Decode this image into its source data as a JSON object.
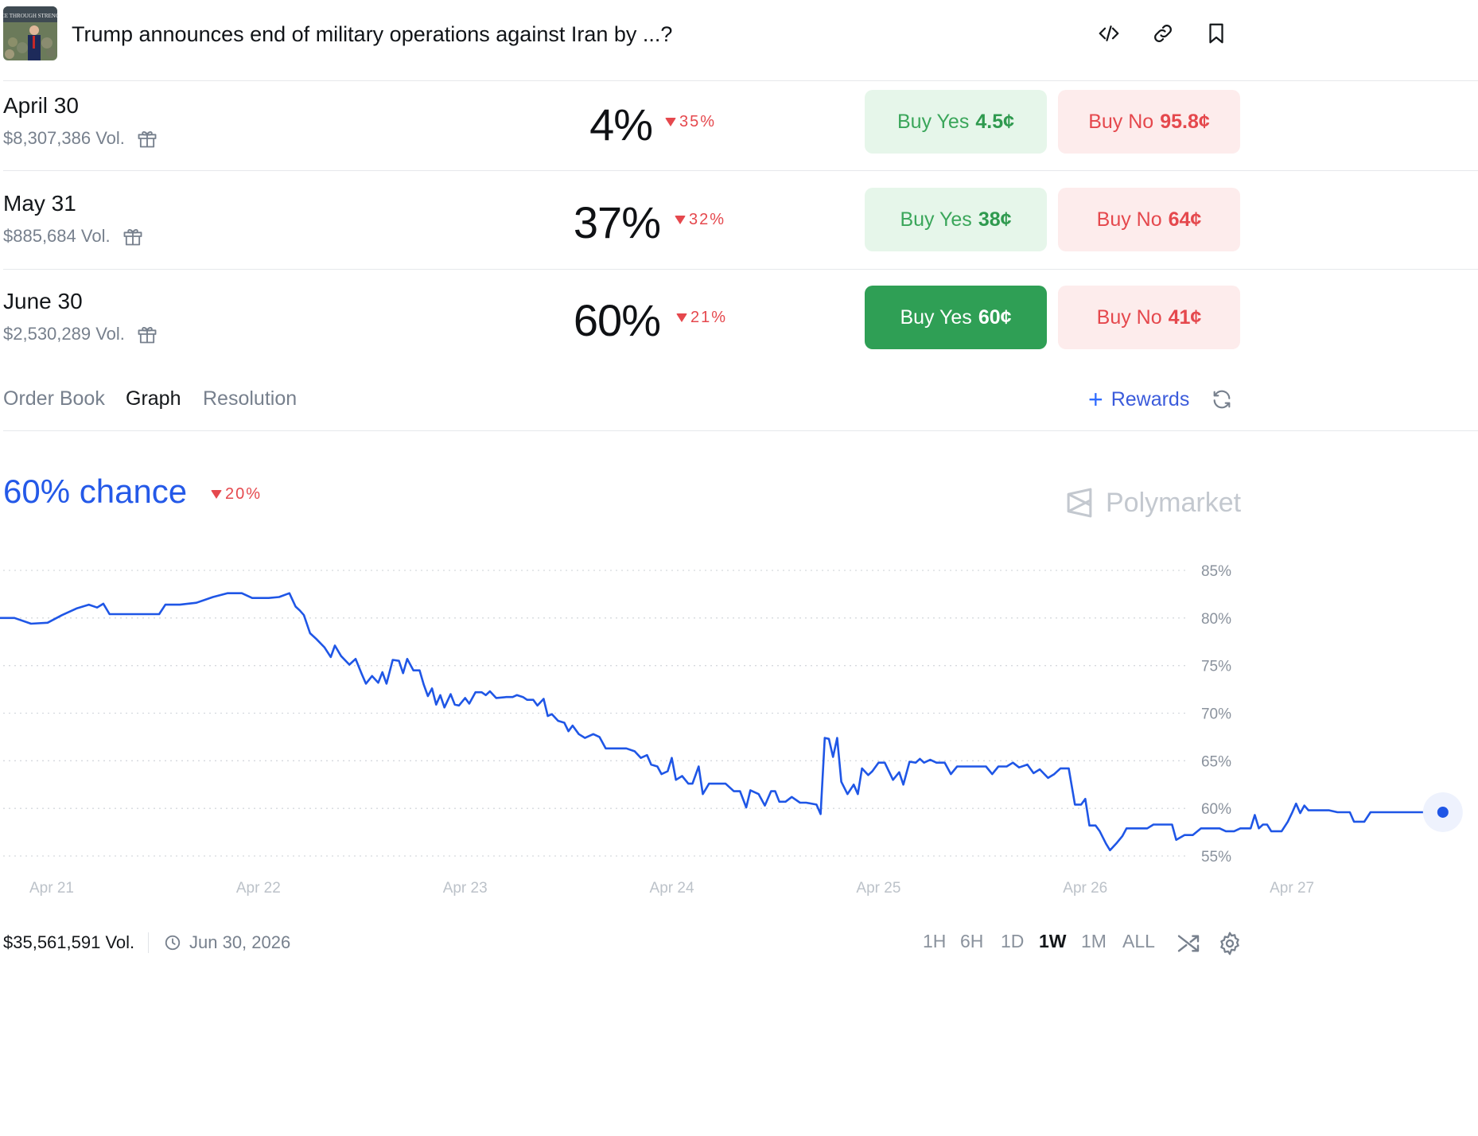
{
  "header": {
    "title": "Trump announces end of military operations against Iran by ...?",
    "thumbnail_caption": "CE THROUGH STRENG"
  },
  "markets": [
    {
      "date": "April 30",
      "volume": "$8,307,386 Vol.",
      "percent": "4%",
      "change": "35%",
      "yes_label": "Buy Yes",
      "yes_price": "4.5¢",
      "no_label": "Buy No",
      "no_price": "95.8¢"
    },
    {
      "date": "May 31",
      "volume": "$885,684 Vol.",
      "percent": "37%",
      "change": "32%",
      "yes_label": "Buy Yes",
      "yes_price": "38¢",
      "no_label": "Buy No",
      "no_price": "64¢"
    },
    {
      "date": "June 30",
      "volume": "$2,530,289 Vol.",
      "percent": "60%",
      "change": "21%",
      "yes_label": "Buy Yes",
      "yes_price": "60¢",
      "no_label": "Buy No",
      "no_price": "41¢"
    }
  ],
  "tabs": [
    "Order Book",
    "Graph",
    "Resolution"
  ],
  "active_tab": "Graph",
  "rewards_label": "Rewards",
  "chance": {
    "label": "60% chance",
    "change": "20%"
  },
  "brand": "Polymarket",
  "colors": {
    "accent": "#2459e8",
    "yes": "#2f9f55",
    "no": "#e5484d"
  },
  "chart_data": {
    "type": "line",
    "ylim": [
      55,
      85
    ],
    "yticks": [
      "85%",
      "80%",
      "75%",
      "70%",
      "65%",
      "60%",
      "55%"
    ],
    "xticks": [
      "Apr 21",
      "Apr 22",
      "Apr 23",
      "Apr 24",
      "Apr 25",
      "Apr 26",
      "Apr 27"
    ],
    "xlim": [
      20.75,
      27.9
    ],
    "series": [
      {
        "values": [
          [
            20.75,
            80
          ],
          [
            20.82,
            80
          ],
          [
            20.9,
            79.4
          ],
          [
            20.98,
            79.5
          ],
          [
            21.05,
            80.3
          ],
          [
            21.12,
            81
          ],
          [
            21.18,
            81.4
          ],
          [
            21.22,
            81.1
          ],
          [
            21.25,
            81.5
          ],
          [
            21.28,
            80.4
          ],
          [
            21.35,
            80.4
          ],
          [
            21.45,
            80.4
          ],
          [
            21.52,
            80.4
          ],
          [
            21.55,
            81.4
          ],
          [
            21.62,
            81.4
          ],
          [
            21.7,
            81.6
          ],
          [
            21.78,
            82.2
          ],
          [
            21.85,
            82.6
          ],
          [
            21.92,
            82.6
          ],
          [
            21.97,
            82.1
          ],
          [
            22.05,
            82.1
          ],
          [
            22.1,
            82.2
          ],
          [
            22.15,
            82.6
          ],
          [
            22.18,
            81.2
          ],
          [
            22.2,
            80.8
          ],
          [
            22.22,
            80.3
          ],
          [
            22.25,
            78.4
          ],
          [
            22.28,
            77.8
          ],
          [
            22.32,
            76.9
          ],
          [
            22.35,
            75.9
          ],
          [
            22.37,
            77.1
          ],
          [
            22.4,
            76
          ],
          [
            22.44,
            75.1
          ],
          [
            22.47,
            75.7
          ],
          [
            22.5,
            74.1
          ],
          [
            22.52,
            73.1
          ],
          [
            22.55,
            73.9
          ],
          [
            22.58,
            73.2
          ],
          [
            22.6,
            74.3
          ],
          [
            22.62,
            73.1
          ],
          [
            22.65,
            75.6
          ],
          [
            22.68,
            75.5
          ],
          [
            22.7,
            74.2
          ],
          [
            22.72,
            75.7
          ],
          [
            22.75,
            74.5
          ],
          [
            22.78,
            74.5
          ],
          [
            22.8,
            73
          ],
          [
            22.82,
            71.8
          ],
          [
            22.84,
            72.6
          ],
          [
            22.86,
            70.9
          ],
          [
            22.88,
            71.9
          ],
          [
            22.9,
            70.6
          ],
          [
            22.93,
            72
          ],
          [
            22.95,
            70.9
          ],
          [
            22.97,
            70.8
          ],
          [
            23,
            71.6
          ],
          [
            23.02,
            71
          ],
          [
            23.05,
            72.2
          ],
          [
            23.08,
            72.2
          ],
          [
            23.1,
            71.9
          ],
          [
            23.12,
            72.3
          ],
          [
            23.15,
            71.6
          ],
          [
            23.2,
            71.7
          ],
          [
            23.23,
            71.7
          ],
          [
            23.25,
            71.9
          ],
          [
            23.28,
            71.7
          ],
          [
            23.3,
            71.4
          ],
          [
            23.33,
            71.4
          ],
          [
            23.35,
            70.8
          ],
          [
            23.38,
            71.5
          ],
          [
            23.4,
            69.7
          ],
          [
            23.42,
            69.9
          ],
          [
            23.45,
            69.2
          ],
          [
            23.48,
            69
          ],
          [
            23.5,
            68.1
          ],
          [
            23.52,
            68.7
          ],
          [
            23.55,
            67.8
          ],
          [
            23.58,
            67.4
          ],
          [
            23.62,
            67.8
          ],
          [
            23.65,
            67.5
          ],
          [
            23.68,
            66.3
          ],
          [
            23.72,
            66.3
          ],
          [
            23.78,
            66.3
          ],
          [
            23.82,
            66
          ],
          [
            23.85,
            65.3
          ],
          [
            23.88,
            65.6
          ],
          [
            23.9,
            64.6
          ],
          [
            23.93,
            64.4
          ],
          [
            23.95,
            63.6
          ],
          [
            23.98,
            63.9
          ],
          [
            24,
            65.3
          ],
          [
            24.02,
            63
          ],
          [
            24.05,
            63.4
          ],
          [
            24.08,
            62.6
          ],
          [
            24.1,
            62.6
          ],
          [
            24.13,
            64.4
          ],
          [
            24.15,
            61.5
          ],
          [
            24.18,
            62.6
          ],
          [
            24.22,
            62.6
          ],
          [
            24.26,
            62.6
          ],
          [
            24.3,
            61.8
          ],
          [
            24.33,
            61.8
          ],
          [
            24.36,
            60.1
          ],
          [
            24.38,
            61.9
          ],
          [
            24.42,
            61.5
          ],
          [
            24.45,
            60.3
          ],
          [
            24.48,
            61.8
          ],
          [
            24.5,
            61.8
          ],
          [
            24.52,
            60.7
          ],
          [
            24.55,
            60.7
          ],
          [
            24.58,
            61.2
          ],
          [
            24.62,
            60.6
          ],
          [
            24.65,
            60.6
          ],
          [
            24.7,
            60.4
          ],
          [
            24.72,
            59.4
          ],
          [
            24.74,
            67.4
          ],
          [
            24.76,
            67.3
          ],
          [
            24.78,
            65.4
          ],
          [
            24.8,
            67.4
          ],
          [
            24.82,
            62.8
          ],
          [
            24.85,
            61.5
          ],
          [
            24.88,
            62.5
          ],
          [
            24.9,
            61.5
          ],
          [
            24.92,
            64.2
          ],
          [
            24.95,
            63.5
          ],
          [
            24.97,
            63.9
          ],
          [
            25,
            64.8
          ],
          [
            25.03,
            64.8
          ],
          [
            25.05,
            63.9
          ],
          [
            25.07,
            63
          ],
          [
            25.1,
            63.8
          ],
          [
            25.12,
            62.5
          ],
          [
            25.15,
            64.9
          ],
          [
            25.18,
            64.8
          ],
          [
            25.2,
            65.2
          ],
          [
            25.22,
            64.8
          ],
          [
            25.25,
            65.1
          ],
          [
            25.28,
            64.8
          ],
          [
            25.32,
            64.8
          ],
          [
            25.35,
            63.6
          ],
          [
            25.38,
            64.4
          ],
          [
            25.42,
            64.4
          ],
          [
            25.48,
            64.4
          ],
          [
            25.52,
            64.4
          ],
          [
            25.55,
            63.6
          ],
          [
            25.58,
            64.4
          ],
          [
            25.62,
            64.4
          ],
          [
            25.65,
            64.8
          ],
          [
            25.68,
            64.3
          ],
          [
            25.72,
            64.6
          ],
          [
            25.75,
            63.7
          ],
          [
            25.78,
            64.1
          ],
          [
            25.82,
            63.2
          ],
          [
            25.85,
            63.6
          ],
          [
            25.88,
            64.2
          ],
          [
            25.92,
            64.2
          ],
          [
            25.95,
            60.4
          ],
          [
            25.98,
            60.4
          ],
          [
            26,
            61
          ],
          [
            26.02,
            58.2
          ],
          [
            26.05,
            58.2
          ],
          [
            26.07,
            57.6
          ],
          [
            26.1,
            56.3
          ],
          [
            26.12,
            55.6
          ],
          [
            26.15,
            56.3
          ],
          [
            26.18,
            57.1
          ],
          [
            26.2,
            57.9
          ],
          [
            26.25,
            57.9
          ],
          [
            26.3,
            57.9
          ],
          [
            26.33,
            58.3
          ],
          [
            26.38,
            58.3
          ],
          [
            26.42,
            58.3
          ],
          [
            26.44,
            56.7
          ],
          [
            26.48,
            57.2
          ],
          [
            26.52,
            57.2
          ],
          [
            26.56,
            57.9
          ],
          [
            26.6,
            57.9
          ],
          [
            26.65,
            57.9
          ],
          [
            26.68,
            57.6
          ],
          [
            26.72,
            57.6
          ],
          [
            26.75,
            57.9
          ],
          [
            26.8,
            57.9
          ],
          [
            26.82,
            59.3
          ],
          [
            26.84,
            57.9
          ],
          [
            26.86,
            58.3
          ],
          [
            26.88,
            58.3
          ],
          [
            26.9,
            57.6
          ],
          [
            26.95,
            57.6
          ],
          [
            26.98,
            58.6
          ],
          [
            27,
            59.5
          ],
          [
            27.02,
            60.5
          ],
          [
            27.04,
            59.5
          ],
          [
            27.06,
            60.3
          ],
          [
            27.08,
            59.8
          ],
          [
            27.12,
            59.8
          ],
          [
            27.18,
            59.8
          ],
          [
            27.22,
            59.6
          ],
          [
            27.28,
            59.6
          ],
          [
            27.3,
            58.6
          ],
          [
            27.35,
            58.6
          ],
          [
            27.38,
            59.6
          ],
          [
            27.45,
            59.6
          ],
          [
            27.55,
            59.6
          ],
          [
            27.65,
            59.6
          ],
          [
            27.73,
            59.6
          ]
        ]
      }
    ]
  },
  "footer": {
    "total_volume": "$35,561,591 Vol.",
    "end_date": "Jun 30, 2026",
    "ranges": [
      "1H",
      "6H",
      "1D",
      "1W",
      "1M",
      "ALL"
    ],
    "active_range": "1W"
  }
}
